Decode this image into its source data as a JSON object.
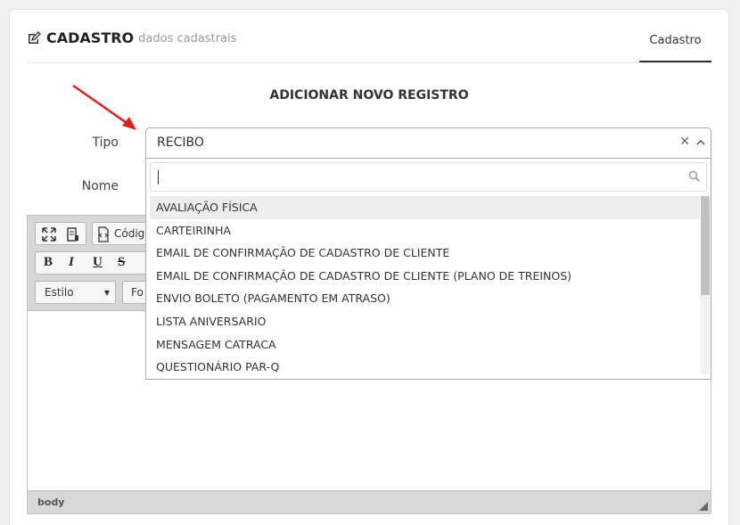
{
  "header": {
    "title": "CADASTRO",
    "subtitle": "dados cadastrais",
    "tab_label": "Cadastro"
  },
  "form": {
    "heading": "ADICIONAR NOVO REGISTRO",
    "tipo_label": "Tipo",
    "nome_label": "Nome",
    "tipo_selected": "RECIBO",
    "search_value": ""
  },
  "dropdown": {
    "options": [
      "AVALIAÇÃO FÍSICA",
      "CARTEIRINHA",
      "EMAIL DE CONFIRMAÇÃO DE CADASTRO DE CLIENTE",
      "EMAIL DE CONFIRMAÇÃO DE CADASTRO DE CLIENTE (PLANO DE TREINOS)",
      "ENVIO BOLETO (PAGAMENTO EM ATRASO)",
      "LISTA ANIVERSARIO",
      "MENSAGEM CATRACA",
      "QUESTIONÁRIO PAR-Q"
    ],
    "highlighted": 0
  },
  "editor": {
    "source_label": "Códig",
    "style_label": "Estilo",
    "font_label": "Fo",
    "bold": "B",
    "italic": "I",
    "underline": "U",
    "strike": "S",
    "status_path": "body"
  },
  "colors": {
    "arrow": "#e02020",
    "accent": "#333333"
  },
  "icons": [
    "edit-icon",
    "clear-icon",
    "chevron-up-icon",
    "search-icon",
    "maximize-icon",
    "preview-icon",
    "source-icon",
    "resize-icon"
  ]
}
